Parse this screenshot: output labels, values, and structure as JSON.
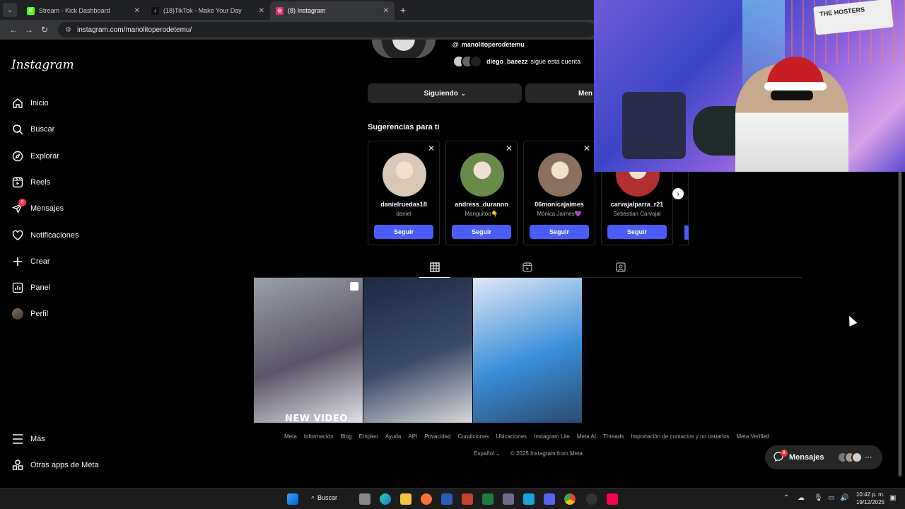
{
  "browser": {
    "tabs": [
      {
        "title": "Stream - Kick Dashboard",
        "favicon": "K",
        "color": "#53fc18",
        "active": false
      },
      {
        "title": "(18)TikTok - Make Your Day",
        "favicon": "♪",
        "color": "#111111",
        "active": false
      },
      {
        "title": "(8) Instagram",
        "favicon": "◎",
        "color": "#e1306c",
        "active": true
      }
    ],
    "url": "instagram.com/manolitoperodetemu/"
  },
  "sidebar": {
    "logo": "Instagram",
    "items": [
      {
        "label": "Inicio",
        "icon": "home-icon"
      },
      {
        "label": "Buscar",
        "icon": "search-icon"
      },
      {
        "label": "Explorar",
        "icon": "compass-icon"
      },
      {
        "label": "Reels",
        "icon": "reels-icon"
      },
      {
        "label": "Mensajes",
        "icon": "messenger-icon",
        "badge": "8"
      },
      {
        "label": "Notificaciones",
        "icon": "heart-icon"
      },
      {
        "label": "Crear",
        "icon": "plus-icon"
      },
      {
        "label": "Panel",
        "icon": "chart-icon"
      },
      {
        "label": "Perfil",
        "icon": "avatar-icon"
      }
    ],
    "more": "Más",
    "meta_apps": "Otras apps de Meta"
  },
  "profile": {
    "threads_handle": "manolitoperodetemu",
    "followed_by_user": "diego_baeezz",
    "followed_by_text": "sigue esta cuenta",
    "following_button": "Siguiendo",
    "message_button": "Men"
  },
  "suggestions": {
    "title": "Sugerencias para ti",
    "follow_label": "Seguir",
    "cards": [
      {
        "username": "danielruedas18",
        "name": "daniel",
        "color": "#d8c8b8"
      },
      {
        "username": "andress_durannn",
        "name": "Manguitoo👇",
        "color": "#6a8a4a"
      },
      {
        "username": "06monicajaimes",
        "name": "Mónica Jaimes💜",
        "color": "#8a7060"
      },
      {
        "username": "carvajalparra_r21",
        "name": "Sebastian Carvajal",
        "color": "#b03030"
      }
    ]
  },
  "posts": [
    {
      "caption": "NEW VIDEO",
      "colors": [
        "#9aa0a8",
        "#5b5566",
        "#e0e0e8"
      ]
    },
    {
      "caption": "",
      "colors": [
        "#1e2a44",
        "#3c4a66",
        "#d8d8d8"
      ]
    },
    {
      "caption": "",
      "colors": [
        "#dfe8f5",
        "#3b8fd8",
        "#2a4a70"
      ]
    }
  ],
  "footer": {
    "links": [
      "Meta",
      "Información",
      "Blog",
      "Empleo",
      "Ayuda",
      "API",
      "Privacidad",
      "Condiciones",
      "Ubicaciones",
      "Instagram Lite",
      "Meta AI",
      "Threads",
      "Importación de contactos y no usuarios",
      "Meta Verified"
    ],
    "language": "Español",
    "copyright": "© 2025 Instagram from Meta"
  },
  "messages_pill": {
    "label": "Mensajes",
    "badge": "8"
  },
  "webcam": {
    "sign_text": "THE HOSTERS"
  },
  "taskbar": {
    "search_label": "Buscar",
    "time": "10:42 p. m.",
    "date": "19/12/2025"
  }
}
